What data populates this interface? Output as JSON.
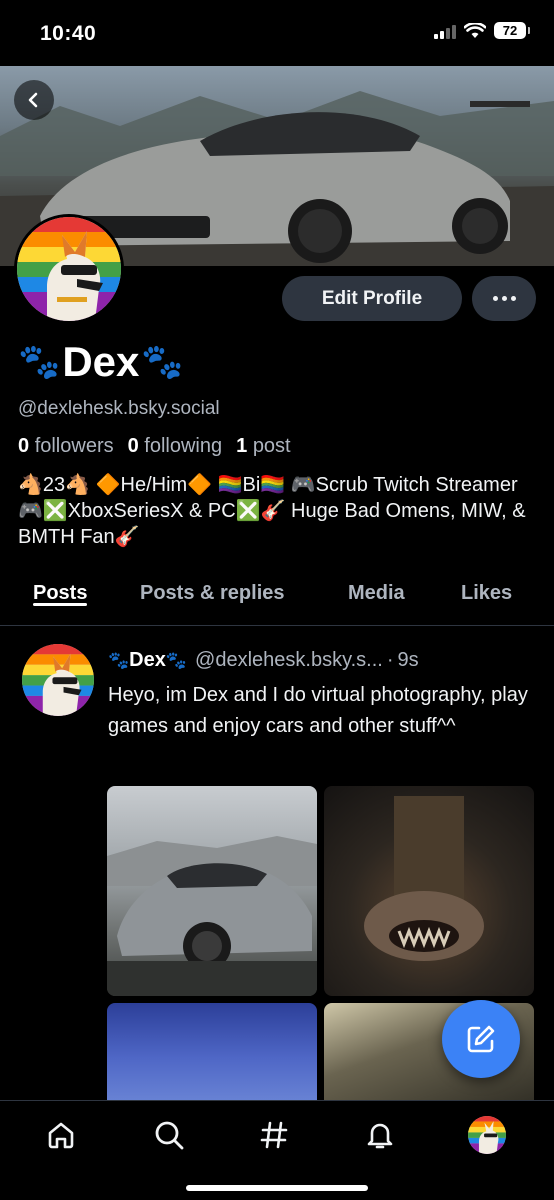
{
  "status_bar": {
    "time": "10:40",
    "battery": "72"
  },
  "profile": {
    "display_name": "Dex",
    "name_emoji": "🐾",
    "handle": "@dexlehesk.bsky.social",
    "followers_count": "0",
    "followers_label": "followers",
    "following_count": "0",
    "following_label": "following",
    "posts_count": "1",
    "posts_label": "post",
    "bio": "🐴23🐴 🔶He/Him🔶 🏳️‍🌈Bi🏳️‍🌈 🎮Scrub Twitch Streamer🎮❎XboxSeriesX & PC❎🎸 Huge Bad Omens, MIW, & BMTH Fan🎸"
  },
  "actions": {
    "edit_profile": "Edit Profile"
  },
  "tabs": [
    {
      "label": "Posts",
      "active": true
    },
    {
      "label": "Posts & replies",
      "active": false
    },
    {
      "label": "Media",
      "active": false
    },
    {
      "label": "Likes",
      "active": false
    }
  ],
  "post": {
    "author_name": "Dex",
    "author_emoji": "🐾",
    "author_handle": "@dexlehesk.bsky.s...",
    "separator": "·",
    "time": "9s",
    "text": "Heyo, im Dex and I do virtual photography, play games and enjoy cars and other stuff^^"
  },
  "colors": {
    "accent": "#3b82f6",
    "button_bg": "#2e3540",
    "muted_text": "#aeb5bf"
  },
  "icons": [
    "back-arrow-icon",
    "more-icon",
    "compose-icon",
    "home-icon",
    "search-icon",
    "feeds-hash-icon",
    "notifications-bell-icon"
  ]
}
